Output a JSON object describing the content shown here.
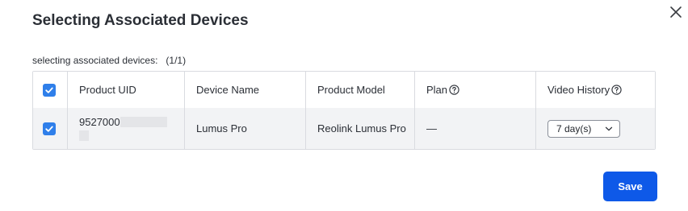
{
  "dialog": {
    "title": "Selecting Associated Devices",
    "count_label": "selecting associated devices:",
    "count_value": "(1/1)",
    "save_label": "Save"
  },
  "table": {
    "columns": [
      "Product UID",
      "Device Name",
      "Product Model",
      "Plan",
      "Video History"
    ],
    "rows": [
      {
        "checked": true,
        "uid_visible": "9527000",
        "device_name": "Lumus Pro",
        "product_model": "Reolink Lumus Pro",
        "plan": "—",
        "video_history": "7 day(s)"
      }
    ]
  },
  "icons": {
    "close": "close-icon",
    "help": "question-circle-icon",
    "check": "checkmark-icon",
    "dropdown": "chevron-down-icon"
  },
  "colors": {
    "accent": "#0e59e8",
    "checkbox": "#2f7fea",
    "row_bg": "#f2f3f5",
    "border": "#d9dbe0"
  }
}
